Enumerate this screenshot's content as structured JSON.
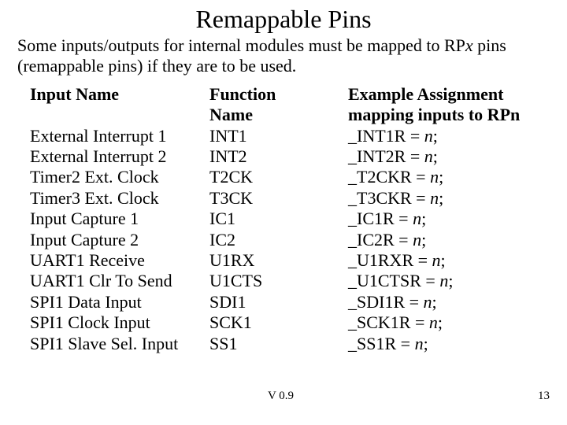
{
  "title": "Remappable Pins",
  "intro_a": "Some inputs/outputs for internal modules must be mapped to RP",
  "intro_x": "x",
  "intro_b": " pins (remappable pins) if they are to be used.",
  "headers": {
    "c1": "Input Name",
    "c2a": "Function",
    "c2b": "Name",
    "c3a": "Example Assignment",
    "c3b_a": "mapping inputs to RP",
    "c3b_n": "n"
  },
  "rows": [
    {
      "name": "External Interrupt 1",
      "func": "INT1",
      "asg_a": "_INT1R = ",
      "asg_n": "n",
      "asg_b": ";"
    },
    {
      "name": "External Interrupt 2",
      "func": "INT2",
      "asg_a": "_INT2R = ",
      "asg_n": "n",
      "asg_b": ";"
    },
    {
      "name": "Timer2 Ext. Clock",
      "func": "T2CK",
      "asg_a": "_T2CKR = ",
      "asg_n": "n",
      "asg_b": ";"
    },
    {
      "name": "Timer3 Ext. Clock",
      "func": "T3CK",
      "asg_a": "_T3CKR = ",
      "asg_n": "n",
      "asg_b": ";"
    },
    {
      "name": "Input Capture 1",
      "func": "IC1",
      "asg_a": "_IC1R = ",
      "asg_n": "n",
      "asg_b": ";"
    },
    {
      "name": "Input Capture 2",
      "func": "IC2",
      "asg_a": "_IC2R = ",
      "asg_n": "n",
      "asg_b": ";"
    },
    {
      "name": "UART1 Receive",
      "func": "U1RX",
      "asg_a": "_U1RXR = ",
      "asg_n": "n",
      "asg_b": ";"
    },
    {
      "name": "UART1 Clr To Send",
      "func": "U1CTS",
      "asg_a": "_U1CTSR = ",
      "asg_n": "n",
      "asg_b": ";"
    },
    {
      "name": "SPI1 Data Input",
      "func": "SDI1",
      "asg_a": "_SDI1R = ",
      "asg_n": "n",
      "asg_b": ";"
    },
    {
      "name": "SPI1 Clock Input",
      "func": "SCK1",
      "asg_a": "_SCK1R = ",
      "asg_n": "n",
      "asg_b": ";"
    },
    {
      "name": "SPI1 Slave Sel. Input",
      "func": "SS1",
      "asg_a": "_SS1R = ",
      "asg_n": "n",
      "asg_b": ";"
    }
  ],
  "footer": {
    "version": "V 0.9",
    "page": "13"
  }
}
